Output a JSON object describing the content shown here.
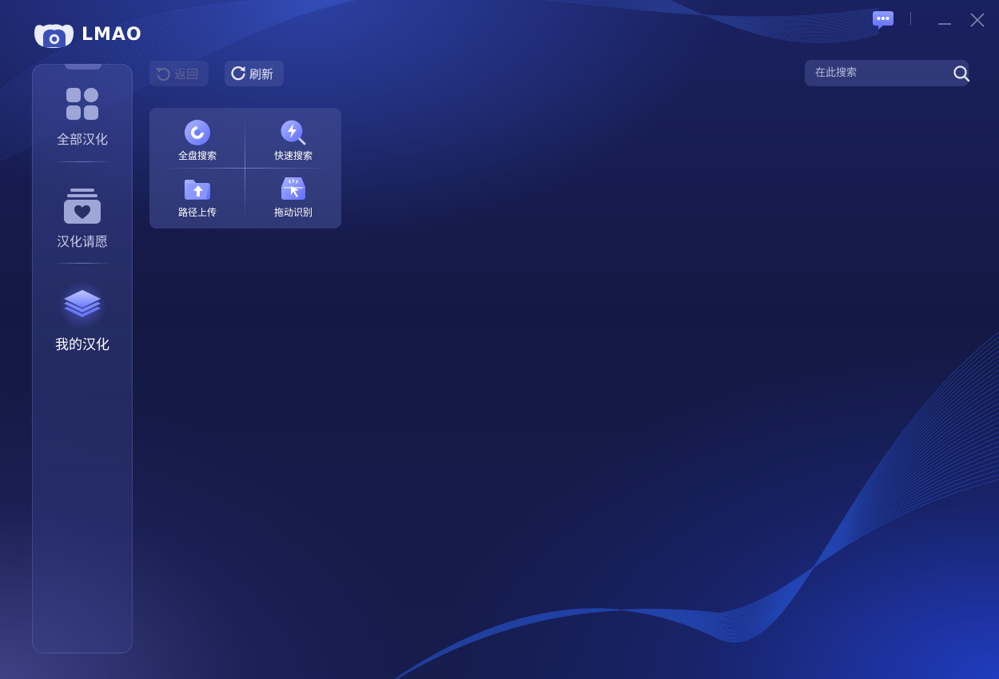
{
  "app": {
    "name": "LMAO"
  },
  "window": {
    "chat_icon": "chat-bubble-icon",
    "minimize_icon": "minimize-icon",
    "close_icon": "close-icon"
  },
  "sidebar": {
    "items": [
      {
        "label": "全部汉化",
        "icon": "grid-apps-icon",
        "active": false
      },
      {
        "label": "汉化请愿",
        "icon": "heart-box-icon",
        "active": false
      },
      {
        "label": "我的汉化",
        "icon": "layers-icon",
        "active": true
      }
    ]
  },
  "toolbar": {
    "back_label": "返回",
    "refresh_label": "刷新"
  },
  "search": {
    "placeholder": "在此搜索",
    "value": ""
  },
  "panel": {
    "items": [
      {
        "label": "全盘搜索",
        "icon": "disk-search-icon"
      },
      {
        "label": "快速搜索",
        "icon": "quick-search-icon"
      },
      {
        "label": "路径上传",
        "icon": "folder-upload-icon"
      },
      {
        "label": "拖动识别",
        "icon": "drag-recognize-icon"
      }
    ]
  },
  "colors": {
    "accent": "#6f7dff",
    "background": "#14183f",
    "accent_bottom_right": "#1d3bd8"
  }
}
